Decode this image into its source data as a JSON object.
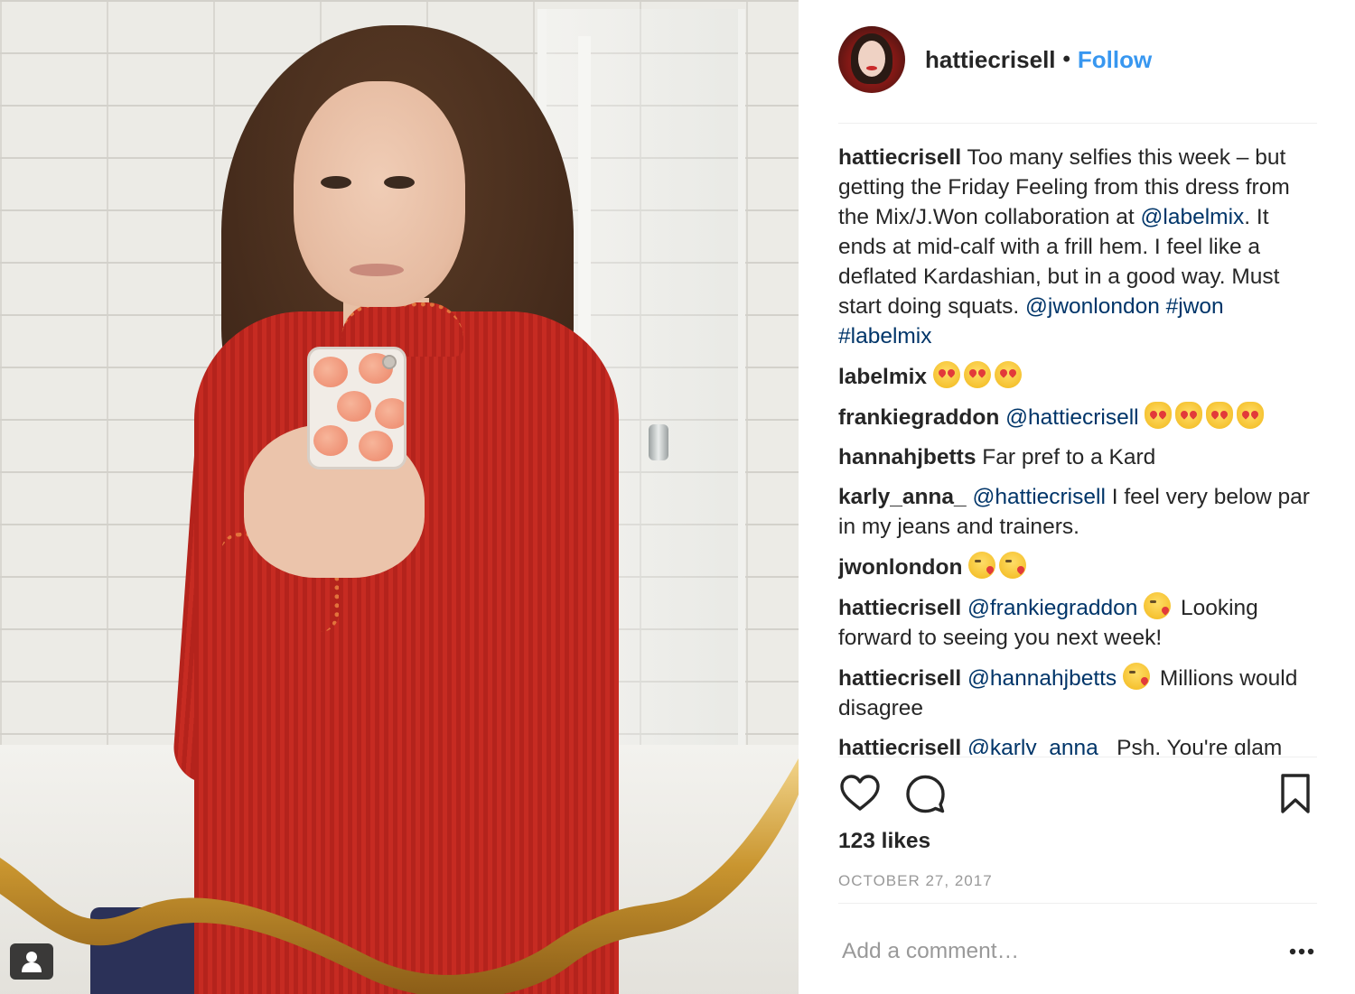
{
  "post": {
    "username": "hattiecrisell",
    "separator": "•",
    "follow_label": "Follow",
    "likes": "123 likes",
    "date": "OCTOBER 27, 2017",
    "add_comment_placeholder": "Add a comment…"
  },
  "caption": {
    "user": "hattiecrisell",
    "text_1": " Too many selfies this week – but getting the Friday Feeling from this dress from the Mix/J.Won collaboration at ",
    "mention": "@labelmix",
    "text_2": ". It ends at mid-calf with a frill hem. I feel like a deflated Kardashian, but in a good way. Must start doing squats. ",
    "tags": [
      "@jwonlondon",
      "#jwon",
      "#labelmix"
    ]
  },
  "comments": [
    {
      "user": "labelmix",
      "mention": "",
      "text": "",
      "emoji": [
        "heart-eyes",
        "heart-eyes",
        "heart-eyes"
      ]
    },
    {
      "user": "frankiegraddon",
      "mention": "@hattiecrisell",
      "text": "",
      "emoji": [
        "heart-eyes-cat",
        "heart-eyes-cat",
        "heart-eyes-cat",
        "heart-eyes-cat"
      ]
    },
    {
      "user": "hannahjbetts",
      "mention": "",
      "text": "Far pref to a Kard",
      "emoji": []
    },
    {
      "user": "karly_anna_",
      "mention": "@hattiecrisell",
      "text": "I feel very below par in my jeans and trainers.",
      "emoji": []
    },
    {
      "user": "jwonlondon",
      "mention": "",
      "text": "",
      "emoji": [
        "kissing-heart",
        "kissing-heart"
      ]
    },
    {
      "user": "hattiecrisell",
      "mention": "@frankiegraddon",
      "text": "Looking forward to seeing you next week!",
      "emoji": [
        "kissing-heart"
      ]
    },
    {
      "user": "hattiecrisell",
      "mention": "@hannahjbetts",
      "text": "Millions would disagree",
      "emoji": [
        "kissing-heart"
      ]
    },
    {
      "user": "hattiecrisell",
      "mention": "@karly_anna_",
      "text": "Psh. You're glam",
      "emoji": []
    }
  ],
  "icons": {
    "like": "heart-icon",
    "comment": "comment-bubble-icon",
    "save": "bookmark-icon",
    "more": "more-options-icon",
    "tag": "user-tag-icon"
  },
  "colors": {
    "link": "#003569",
    "follow": "#3897f0",
    "text": "#262626",
    "muted": "#999999"
  }
}
